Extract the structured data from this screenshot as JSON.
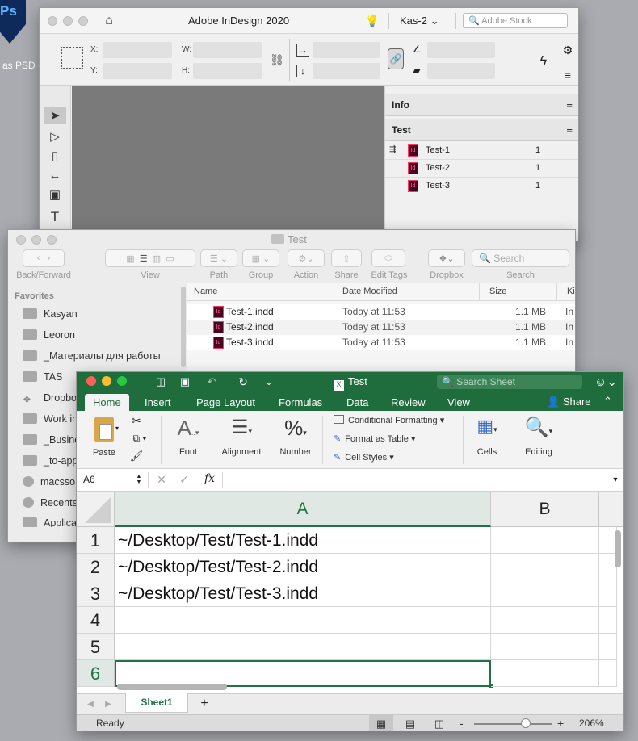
{
  "desktop": {
    "ps_badge": "Ps",
    "label": "as PSD"
  },
  "indesign": {
    "title": "Adobe InDesign 2020",
    "workspace": "Kas-2",
    "search_placeholder": "Adobe Stock",
    "x_label": "X:",
    "y_label": "Y:",
    "w_label": "W:",
    "h_label": "H:",
    "panels": {
      "info": "Info",
      "test": "Test"
    },
    "pages": [
      {
        "name": "Test-1",
        "pages": "1"
      },
      {
        "name": "Test-2",
        "pages": "1"
      },
      {
        "name": "Test-3",
        "pages": "1"
      }
    ]
  },
  "finder": {
    "title": "Test",
    "toolbar": {
      "back_forward": "Back/Forward",
      "view": "View",
      "path": "Path",
      "group": "Group",
      "action": "Action",
      "share": "Share",
      "edit_tags": "Edit Tags",
      "dropbox": "Dropbox",
      "search_label": "Search",
      "search_placeholder": "Search"
    },
    "sidebar_heading": "Favorites",
    "favorites": [
      "Kasyan",
      "Leoron",
      "_Материалы для работы",
      "TAS",
      "Dropbox",
      "Work in",
      "_Busine",
      "_to-app",
      "macsso",
      "Recents",
      "Applica"
    ],
    "columns": {
      "name": "Name",
      "date": "Date Modified",
      "size": "Size",
      "kind": "Ki"
    },
    "files": [
      {
        "name": "Test-1.indd",
        "date": "Today at 11:53",
        "size": "1.1 MB",
        "kind": "In"
      },
      {
        "name": "Test-2.indd",
        "date": "Today at 11:53",
        "size": "1.1 MB",
        "kind": "In"
      },
      {
        "name": "Test-3.indd",
        "date": "Today at 11:53",
        "size": "1.1 MB",
        "kind": "In"
      }
    ]
  },
  "excel": {
    "title": "Test",
    "search_placeholder": "Search Sheet",
    "tabs": [
      "Home",
      "Insert",
      "Page Layout",
      "Formulas",
      "Data",
      "Review",
      "View"
    ],
    "share": "Share",
    "ribbon": {
      "paste": "Paste",
      "font": "Font",
      "alignment": "Alignment",
      "number": "Number",
      "conditional": "Conditional Formatting",
      "format_table": "Format as Table",
      "cell_styles": "Cell Styles",
      "cells": "Cells",
      "editing": "Editing"
    },
    "name_box": "A6",
    "fx": "fx",
    "columns": [
      "A",
      "B"
    ],
    "rows": [
      {
        "num": "1",
        "a": "~/Desktop/Test/Test-1.indd",
        "b": ""
      },
      {
        "num": "2",
        "a": "~/Desktop/Test/Test-2.indd",
        "b": ""
      },
      {
        "num": "3",
        "a": "~/Desktop/Test/Test-3.indd",
        "b": ""
      },
      {
        "num": "4",
        "a": "",
        "b": ""
      },
      {
        "num": "5",
        "a": "",
        "b": ""
      },
      {
        "num": "6",
        "a": "",
        "b": ""
      }
    ],
    "sheet_tab": "Sheet1",
    "add_sheet": "+",
    "status": "Ready",
    "zoom": "206%",
    "zoom_minus": "-",
    "zoom_plus": "+"
  },
  "colors": {
    "excel_green": "#1f6d3c",
    "indd_red": "#49021f",
    "selection_green": "#217346"
  }
}
